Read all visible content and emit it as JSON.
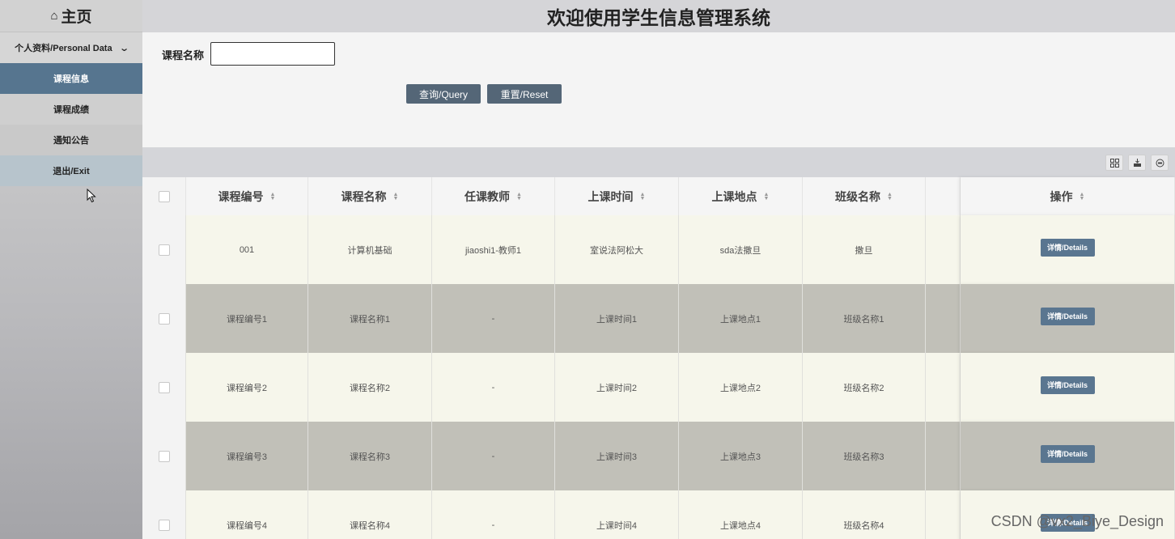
{
  "sidebar": {
    "home": "主页",
    "group": "个人资料/Personal Data",
    "items": [
      {
        "label": "课程信息"
      },
      {
        "label": "课程成绩"
      },
      {
        "label": "通知公告"
      },
      {
        "label": "退出/Exit"
      }
    ]
  },
  "header": {
    "title": "欢迎使用学生信息管理系统"
  },
  "search": {
    "label": "课程名称",
    "value": "",
    "query_label": "查询/Query",
    "reset_label": "重置/Reset"
  },
  "table": {
    "columns": [
      "课程编号",
      "课程名称",
      "任课教师",
      "上课时间",
      "上课地点",
      "班级名称",
      "",
      "操作"
    ],
    "rows": [
      [
        "001",
        "计算机基础",
        "jiaoshi1-教师1",
        "室说法阿松大",
        "sda法撒旦",
        "撒旦",
        ""
      ],
      [
        "课程编号1",
        "课程名称1",
        "-",
        "上课时间1",
        "上课地点1",
        "班级名称1",
        ""
      ],
      [
        "课程编号2",
        "课程名称2",
        "-",
        "上课时间2",
        "上课地点2",
        "班级名称2",
        ""
      ],
      [
        "课程编号3",
        "课程名称3",
        "-",
        "上课时间3",
        "上课地点3",
        "班级名称3",
        ""
      ],
      [
        "课程编号4",
        "课程名称4",
        "-",
        "上课时间4",
        "上课地点4",
        "班级名称4",
        ""
      ]
    ],
    "details_label": "详情/Details"
  },
  "watermark": "CSDN @vx2_Biye_Design"
}
